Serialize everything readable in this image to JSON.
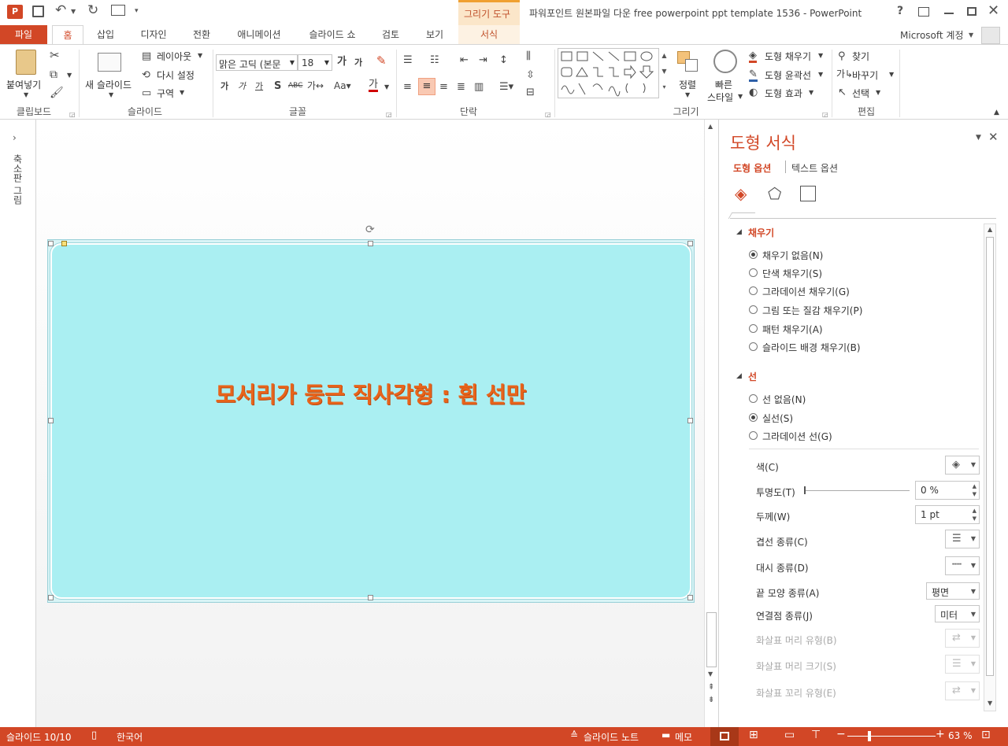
{
  "titlebar": {
    "contextual_tab": "그리기 도구",
    "title": "파워포인트 원본파일 다운 free powerpoint ppt template 1536 - PowerPoint",
    "help": "?",
    "account": "Microsoft 계정"
  },
  "tabs": [
    "파일",
    "홈",
    "삽입",
    "디자인",
    "전환",
    "애니메이션",
    "슬라이드 쇼",
    "검토",
    "보기",
    "서식"
  ],
  "ribbon": {
    "clipboard": {
      "paste": "붙여넣기",
      "label": "클립보드"
    },
    "slides": {
      "new_slide": "새 슬라이드",
      "layout": "레이아웃",
      "reset": "다시 설정",
      "section": "구역",
      "label": "슬라이드"
    },
    "font": {
      "font_name": "맑은 고딕 (본문",
      "font_size": "18",
      "label": "글꼴"
    },
    "paragraph": {
      "label": "단락"
    },
    "drawing": {
      "arrange": "정렬",
      "quick_styles_1": "빠른",
      "quick_styles_2": "스타일",
      "shape_fill": "도형 채우기",
      "shape_outline": "도형 윤곽선",
      "shape_effects": "도형 효과",
      "label": "그리기"
    },
    "editing": {
      "find": "찾기",
      "replace": "바꾸기",
      "select": "선택",
      "label": "편집"
    }
  },
  "leftpane": {
    "label": "축소판 그림"
  },
  "slide": {
    "text": "모서리가 둥근 직사각형 : 흰 선만",
    "fill_color": "#aaeff2",
    "text_color": "#e8641b"
  },
  "format_pane": {
    "title": "도형 서식",
    "tab_shape": "도형 옵션",
    "tab_text": "텍스트 옵션",
    "fill_section": "채우기",
    "fill_options": [
      {
        "label": "채우기 없음(N)",
        "selected": true
      },
      {
        "label": "단색 채우기(S)",
        "selected": false
      },
      {
        "label": "그라데이션 채우기(G)",
        "selected": false
      },
      {
        "label": "그림 또는 질감 채우기(P)",
        "selected": false
      },
      {
        "label": "패턴 채우기(A)",
        "selected": false
      },
      {
        "label": "슬라이드 배경 채우기(B)",
        "selected": false
      }
    ],
    "line_section": "선",
    "line_options": [
      {
        "label": "선 없음(N)",
        "selected": false
      },
      {
        "label": "실선(S)",
        "selected": true
      },
      {
        "label": "그라데이션 선(G)",
        "selected": false
      }
    ],
    "props": {
      "color": "색(C)",
      "transparency": "투명도(T)",
      "transparency_value": "0 %",
      "width": "두께(W)",
      "width_value": "1 pt",
      "compound": "겹선 종류(C)",
      "dash": "대시 종류(D)",
      "cap": "끝 모양 종류(A)",
      "cap_value": "평면",
      "join": "연결점 종류(J)",
      "join_value": "미터",
      "begin_arrow_type": "화살표 머리 유형(B)",
      "begin_arrow_size": "화살표 머리 크기(S)",
      "end_arrow_type": "화살표 꼬리 유형(E)"
    }
  },
  "statusbar": {
    "slide": "슬라이드 10/10",
    "language": "한국어",
    "notes": "슬라이드 노트",
    "comments": "메모",
    "zoom": "63 %"
  },
  "colors": {
    "accent": "#d24726"
  }
}
